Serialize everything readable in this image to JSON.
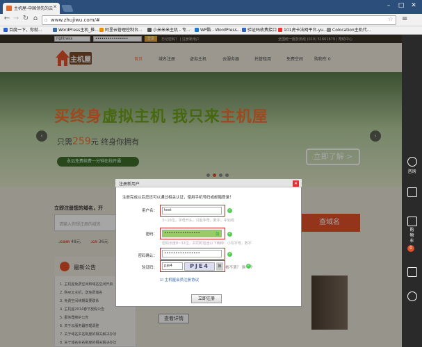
{
  "browser": {
    "tab_title": "主机屋-中国领先的云服务",
    "url": "www.zhujiwu.com/#",
    "bookmarks": [
      {
        "label": "百度一下，你就...",
        "color": "#2a5fd0"
      },
      {
        "label": "WordPress主机_推...",
        "color": "#3a6a9a"
      },
      {
        "label": "阿里云管理控制台...",
        "color": "#f28b00"
      },
      {
        "label": "小米米米主机 - 专...",
        "color": "#555"
      },
      {
        "label": "WP酷 - WordPress...",
        "color": "#1e7ac8"
      },
      {
        "label": "验证码收费接口",
        "color": "#36b"
      },
      {
        "label": "101虎卡法网平台-yu...",
        "color": "#e33"
      },
      {
        "label": "Colocation主机代...",
        "color": "#888"
      }
    ]
  },
  "topstrip": {
    "username_value": "rightness",
    "password_value": "••••••••••••••••",
    "login_label": "登录",
    "forgot": "忘记密码？ | 注册新用户",
    "hotline": "全国统一服务热线 (010) 51661879  |  帮助中心"
  },
  "header": {
    "logo_text": "主机屋",
    "nav": [
      "首页",
      "域名注册",
      "虚拟主机",
      "云服务器",
      "托管租用",
      "免费空间",
      "购物车 0"
    ]
  },
  "banner": {
    "headline_a": "买",
    "headline_b": "终身",
    "headline_c": "虚拟主机 我只来",
    "headline_d": "主机屋",
    "subline_a": "只需",
    "subline_price": "259",
    "subline_b": "元 终身你拥有",
    "pill": "永远免费续费一分钟在线开通",
    "learn_more": "立即了解 >"
  },
  "domain": {
    "title": "立即注册您的域名，开",
    "placeholder": "请输入你想注册的域名",
    "query_btn": "查域名",
    "prices": [
      {
        "tld": ".com",
        "price": "48元"
      },
      {
        "tld": ".cn",
        "price": "36元"
      }
    ]
  },
  "notice": {
    "title": "最新公告",
    "items": [
      "1. 主机屋免费空间和域名空间开启",
      "2. 购买云主机，送免费域名",
      "3. 免费空间续期需要联系",
      "4. 主机屋2014春节放假公告",
      "5. 服务器维护公告",
      "6. 关于云服务器管理调整",
      "7. 关于域名实名制度的相关解决办法",
      "8. 关于域名实名制度的相关解决办法"
    ],
    "view_detail": "查看详情"
  },
  "sidebar": {
    "items": [
      "咨询",
      "",
      "购物车",
      "",
      ""
    ],
    "cart_count": "0"
  },
  "dialog": {
    "title": "注册新用户",
    "close": "✕",
    "intro": "注册完成以后您还可以通过相关认证，使用手机号码或邮箱登录！",
    "username_label": "用户名：",
    "username_value": "test",
    "username_hint": "3~16位，字母开头，只能字母，数字，中划线",
    "password_label": "密码：",
    "password_value": "••••••••••••••••",
    "password_strength": "强",
    "password_hint": "密码长度8~32位，并同时包含以下两种：小写字母，数字",
    "confirm_label": "密码确认：",
    "confirm_value": "••••••••••••••••",
    "captcha_label": "验证码：",
    "captcha_value": "pje4",
    "captcha_image_text": "PJE4",
    "captcha_refresh": "换",
    "cant_read": "看不清？ 换一个",
    "agree": "☑ 主机屋会员注册协议",
    "register_btn": "立即注册"
  }
}
